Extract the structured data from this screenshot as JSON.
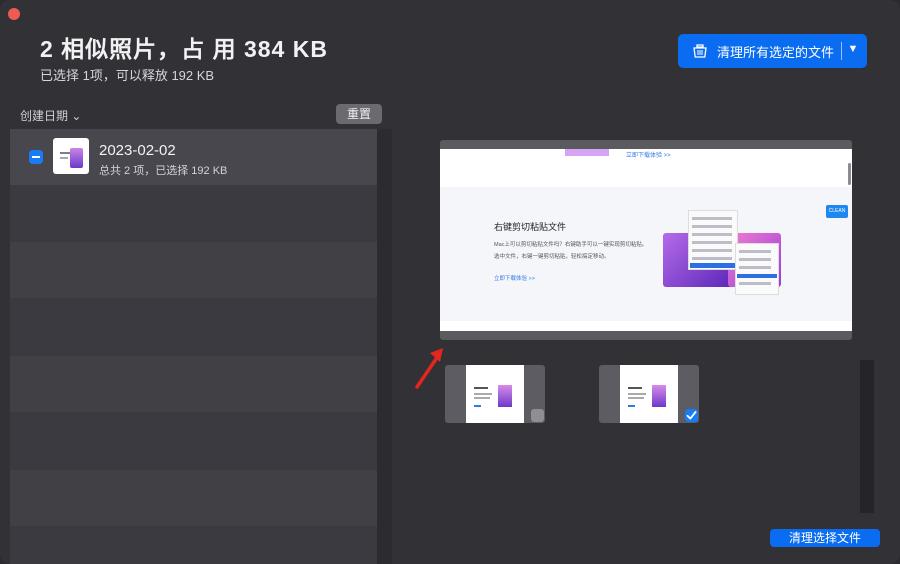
{
  "header": {
    "title": "2 相似照片，占 用 384 KB",
    "subtitle": "已选择 1项，可以释放 192 KB",
    "clean_all_button": "清理所有选定的文件",
    "dropdown_caret": "▼"
  },
  "toolbar": {
    "sort_label": "创建日期",
    "sort_caret": "⌄",
    "reset_button": "重置"
  },
  "groups": [
    {
      "date": "2023-02-02",
      "summary": "总共 2 项，已选择 192 KB",
      "selected": true
    }
  ],
  "preview": {
    "top_link": "立即下载体验 >>",
    "heading": "右键剪切粘贴文件",
    "line1": "Mac上可以剪切粘贴文件吗？右键助手可以一键实现剪切粘贴。",
    "line2": "选中文件，右键一键剪切粘贴，轻松搞定移动。",
    "link": "立即下载体验 >>",
    "badge": "CLEAN"
  },
  "thumbnails": [
    {
      "checked": false
    },
    {
      "checked": true
    }
  ],
  "footer": {
    "clean_selected_button": "清理选择文件"
  },
  "colors": {
    "accent": "#0a6cf0",
    "annotation_arrow": "#e5261f"
  }
}
